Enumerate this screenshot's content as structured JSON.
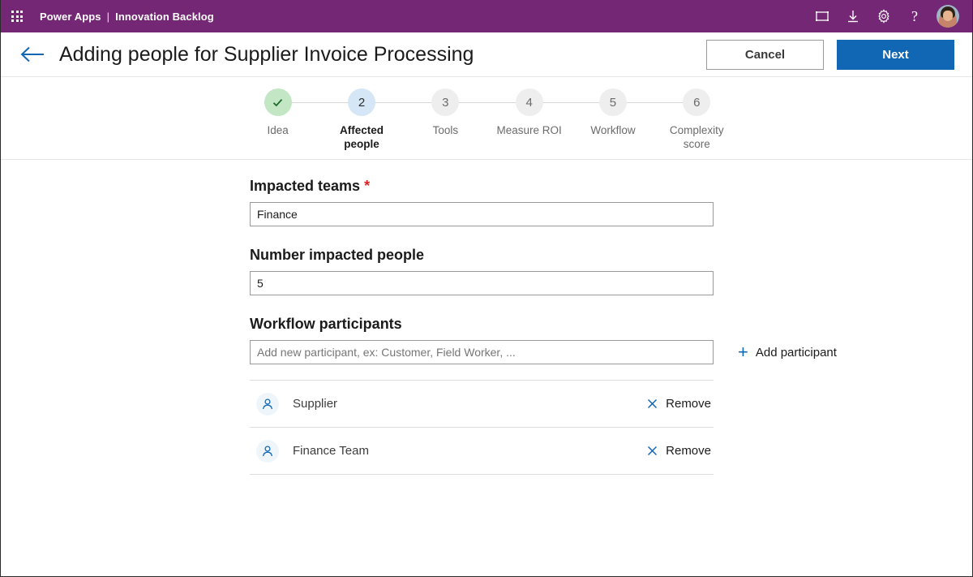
{
  "suitebar": {
    "waffle_icon": "waffle-grid-icon",
    "app_name": "Power Apps",
    "separator": "|",
    "context_name": "Innovation Backlog",
    "icons": [
      {
        "name": "screen-fit-icon",
        "label": ""
      },
      {
        "name": "download-icon",
        "label": ""
      },
      {
        "name": "settings-gear-icon",
        "label": ""
      },
      {
        "name": "help-icon",
        "label": "?"
      }
    ],
    "avatar_label": "user-avatar"
  },
  "commandbar": {
    "back_icon": "back-arrow-icon",
    "title": "Adding people for Supplier Invoice Processing",
    "cancel_label": "Cancel",
    "next_label": "Next"
  },
  "stepper": {
    "steps": [
      {
        "marker": "✓",
        "label": "Idea",
        "state": "done"
      },
      {
        "marker": "2",
        "label": "Affected people",
        "state": "current"
      },
      {
        "marker": "3",
        "label": "Tools",
        "state": "pending"
      },
      {
        "marker": "4",
        "label": "Measure ROI",
        "state": "pending"
      },
      {
        "marker": "5",
        "label": "Workflow",
        "state": "pending"
      },
      {
        "marker": "6",
        "label": "Complexity score",
        "state": "pending"
      }
    ]
  },
  "form": {
    "impacted_teams": {
      "label": "Impacted teams",
      "required_marker": "*",
      "value": "Finance",
      "placeholder": ""
    },
    "number_impacted_people": {
      "label": "Number impacted people",
      "value": "5",
      "placeholder": ""
    },
    "workflow_participants": {
      "label": "Workflow participants",
      "input_value": "",
      "placeholder": "Add new participant, ex: Customer, Field Worker, ...",
      "add_label": "Add participant",
      "add_plus": "+",
      "remove_label": "Remove",
      "items": [
        {
          "name": "Supplier"
        },
        {
          "name": "Finance Team"
        }
      ]
    }
  },
  "colors": {
    "suitebar_purple": "#742774",
    "primary_blue": "#1267b4",
    "step_done_green": "#c3e7c4",
    "step_current_blue": "#d5e7f7",
    "step_pending_gray": "#eeeeee",
    "required_red": "#e02020"
  }
}
